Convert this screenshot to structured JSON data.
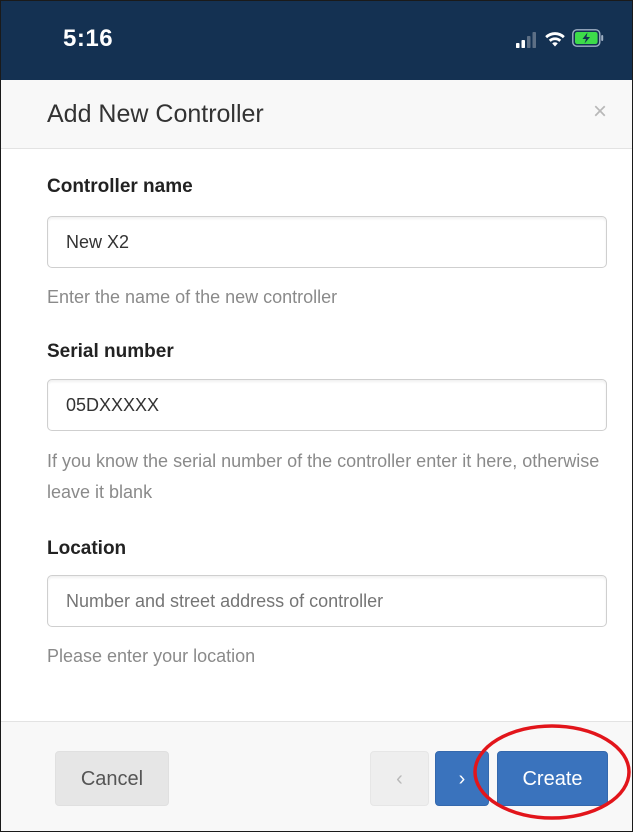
{
  "status_bar": {
    "time": "5:16",
    "icons": [
      "cellular-signal-icon",
      "wifi-icon",
      "battery-charging-icon"
    ],
    "background_color": "#143152",
    "battery_color": "#3ddc4a"
  },
  "modal": {
    "title": "Add New Controller",
    "close_symbol": "×",
    "fields": [
      {
        "label": "Controller name",
        "value": "New X2",
        "placeholder": "",
        "help": "Enter the name of the new controller"
      },
      {
        "label": "Serial number",
        "value": "05DXXXXX",
        "placeholder": "",
        "help": "If you know the serial number of the controller enter it here, otherwise leave it blank"
      },
      {
        "label": "Location",
        "value": "",
        "placeholder": "Number and street address of controller",
        "help": "Please enter your location"
      }
    ],
    "footer": {
      "cancel_label": "Cancel",
      "prev_symbol": "‹",
      "next_symbol": "›",
      "create_label": "Create"
    }
  },
  "colors": {
    "primary_button": "#3a73bd",
    "highlight_ring": "#e2151b",
    "help_text": "#8a8a8a"
  }
}
